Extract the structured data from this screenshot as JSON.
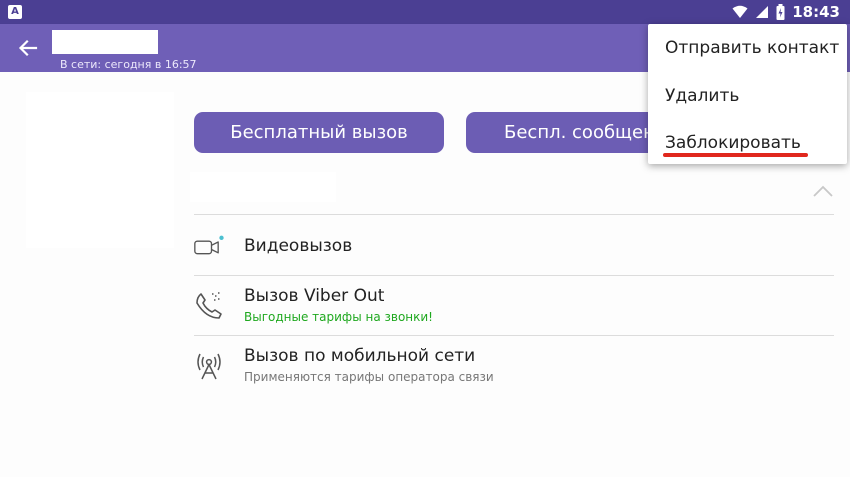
{
  "status_bar": {
    "app_badge": "A",
    "time": "18:43"
  },
  "toolbar": {
    "last_seen": "В сети: сегодня в 16:57"
  },
  "actions": {
    "free_call": "Бесплатный вызов",
    "free_message": "Беспл. сообщение"
  },
  "options": [
    {
      "title": "Видеовызов",
      "subtitle": ""
    },
    {
      "title": "Вызов Viber Out",
      "subtitle": "Выгодные тарифы на звонки!"
    },
    {
      "title": "Вызов по мобильной сети",
      "subtitle": "Применяются тарифы оператора связи"
    }
  ],
  "menu": {
    "items": [
      "Отправить контакт",
      "Удалить",
      "Заблокировать"
    ]
  },
  "colors": {
    "toolbar": "#6f5fb7",
    "status_bar": "#4b3f93",
    "button": "#6c5db4",
    "promo_green": "#1fa81f",
    "highlight_underline": "#e0271d",
    "online_dot": "#4cc0d0"
  }
}
